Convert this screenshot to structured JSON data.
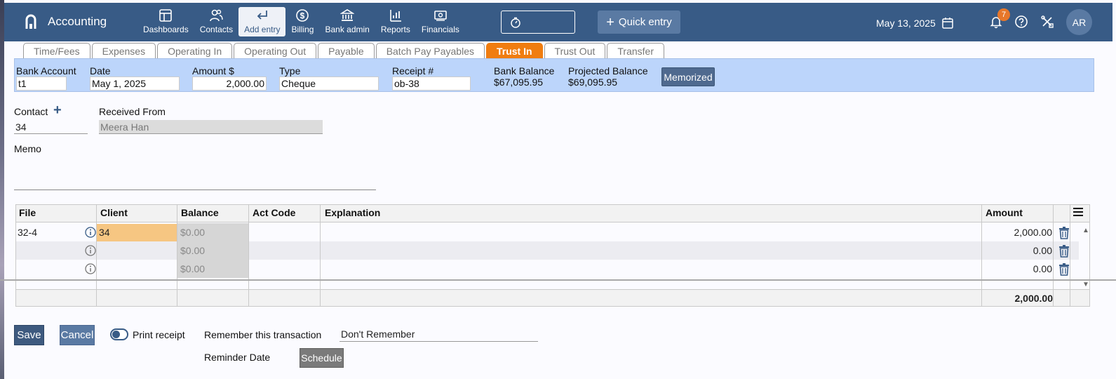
{
  "app": {
    "name": "Accounting"
  },
  "nav": [
    {
      "label": "Dashboards",
      "icon": "dashboard-icon"
    },
    {
      "label": "Contacts",
      "icon": "contacts-icon"
    },
    {
      "label": "Add entry",
      "icon": "add-entry-icon",
      "active": true
    },
    {
      "label": "Billing",
      "icon": "billing-icon"
    },
    {
      "label": "Bank admin",
      "icon": "bank-icon"
    },
    {
      "label": "Reports",
      "icon": "reports-icon"
    },
    {
      "label": "Financials",
      "icon": "financials-icon"
    }
  ],
  "quick_entry": "Quick entry",
  "top_date": "May 13, 2025",
  "notifications_count": "7",
  "avatar": "AR",
  "tabs": [
    "Time/Fees",
    "Expenses",
    "Operating In",
    "Operating Out",
    "Payable",
    "Batch Pay Payables",
    "Trust In",
    "Trust Out",
    "Transfer"
  ],
  "active_tab": "Trust In",
  "header": {
    "bank_account_label": "Bank Account",
    "bank_account": "t1",
    "date_label": "Date",
    "date": "May 1, 2025",
    "amount_label": "Amount $",
    "amount": "2,000.00",
    "type_label": "Type",
    "type": "Cheque",
    "receipt_label": "Receipt #",
    "receipt": "ob-38",
    "bank_balance_label": "Bank Balance",
    "bank_balance": "$67,095.95",
    "projected_balance_label": "Projected Balance",
    "projected_balance": "$69,095.95",
    "memorized_label": "Memorized"
  },
  "contact": {
    "label": "Contact",
    "value": "34"
  },
  "received_from": {
    "label": "Received From",
    "value": "Meera Han"
  },
  "memo": {
    "label": "Memo",
    "value": ""
  },
  "grid": {
    "columns": [
      "File",
      "Client",
      "Balance",
      "Act Code",
      "Explanation",
      "Amount"
    ],
    "rows": [
      {
        "file": "32-4",
        "client": "34",
        "balance": "$0.00",
        "act_code": "",
        "explanation": "",
        "amount": "2,000.00"
      },
      {
        "file": "",
        "client": "",
        "balance": "$0.00",
        "act_code": "",
        "explanation": "",
        "amount": "0.00"
      },
      {
        "file": "",
        "client": "",
        "balance": "$0.00",
        "act_code": "",
        "explanation": "",
        "amount": "0.00"
      }
    ],
    "total": "2,000.00"
  },
  "footer": {
    "save": "Save",
    "cancel": "Cancel",
    "print_receipt": "Print receipt",
    "remember_label": "Remember this transaction",
    "remember_value": "Don't Remember",
    "reminder_label": "Reminder Date",
    "schedule": "Schedule"
  },
  "colors": {
    "topbar": "#385b86",
    "active_tab": "#f07d10",
    "header_strip": "#bcd5fb",
    "client_highlight": "#f6c682"
  }
}
